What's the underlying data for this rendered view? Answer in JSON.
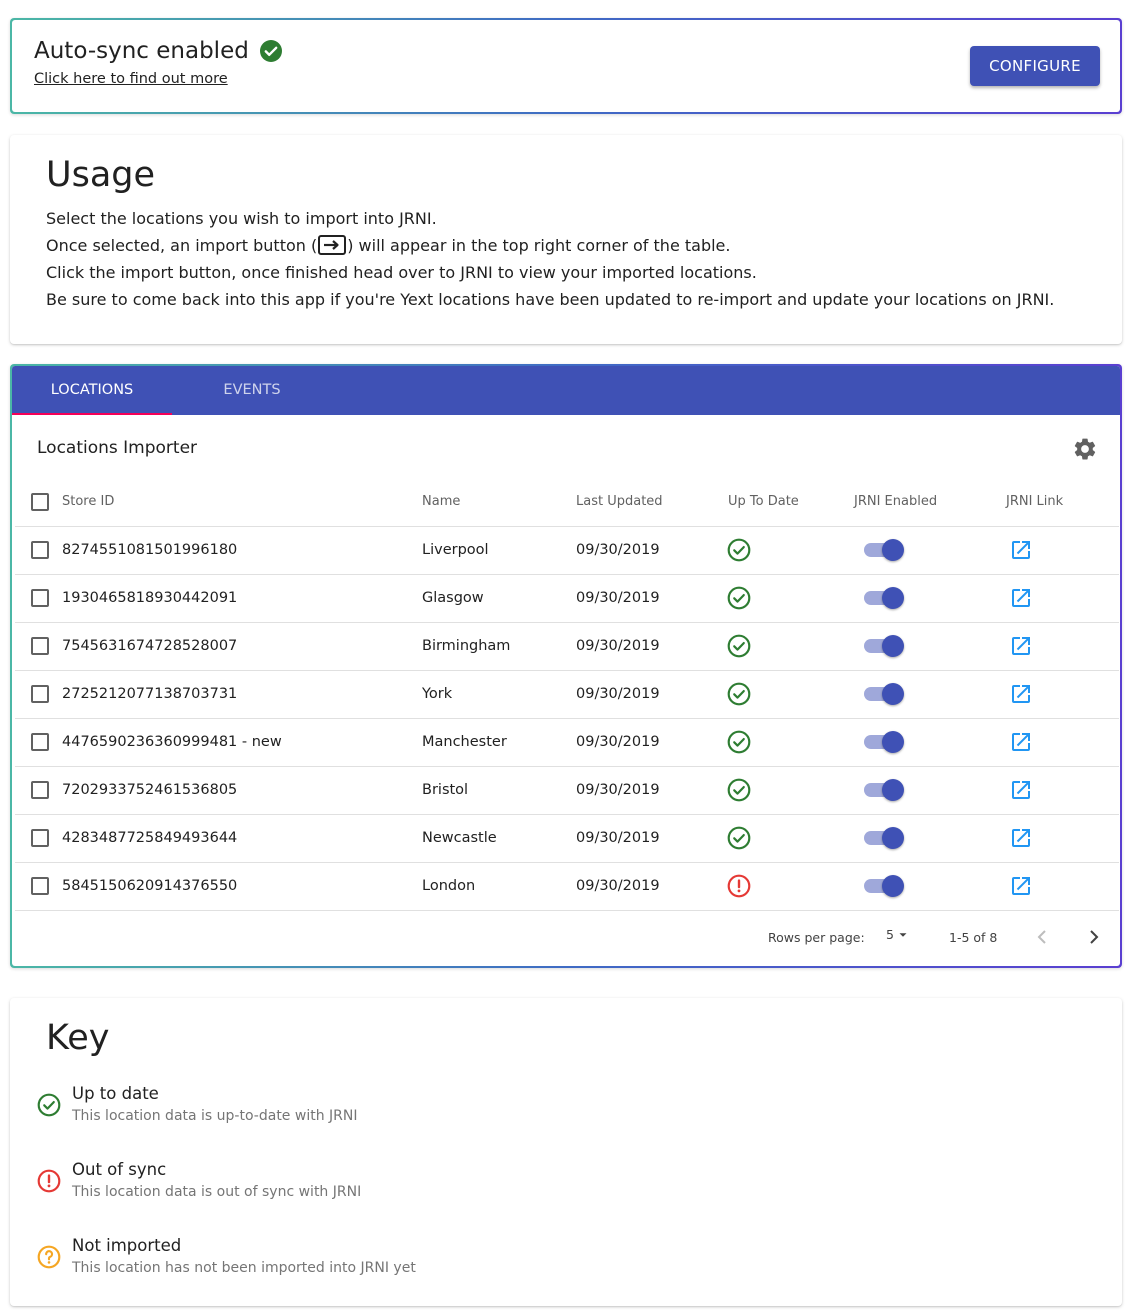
{
  "banner": {
    "title": "Auto-sync enabled",
    "link_text": "Click here to find out more",
    "configure_label": "CONFIGURE"
  },
  "usage": {
    "title": "Usage",
    "line1": "Select the locations you wish to import into JRNI.",
    "line2_before": "Once selected, an import button (",
    "line2_after": ") will appear in the top right corner of the table.",
    "line3": "Click the import button, once finished head over to JRNI to view your imported locations.",
    "line4": "Be sure to come back into this app if you're Yext locations have been updated to re-import and update your locations on JRNI."
  },
  "tabs": [
    "LOCATIONS",
    "EVENTS"
  ],
  "table": {
    "title": "Locations Importer",
    "columns": [
      "Store ID",
      "Name",
      "Last Updated",
      "Up To Date",
      "JRNI Enabled",
      "JRNI Link"
    ],
    "rows": [
      {
        "store_id": "8274551081501996180",
        "name": "Liverpool",
        "last_updated": "09/30/2019",
        "status": "up-to-date",
        "enabled": true
      },
      {
        "store_id": "1930465818930442091",
        "name": "Glasgow",
        "last_updated": "09/30/2019",
        "status": "up-to-date",
        "enabled": true
      },
      {
        "store_id": "7545631674728528007",
        "name": "Birmingham",
        "last_updated": "09/30/2019",
        "status": "up-to-date",
        "enabled": true
      },
      {
        "store_id": "2725212077138703731",
        "name": "York",
        "last_updated": "09/30/2019",
        "status": "up-to-date",
        "enabled": true
      },
      {
        "store_id": "4476590236360999481 - new",
        "name": "Manchester",
        "last_updated": "09/30/2019",
        "status": "up-to-date",
        "enabled": true
      },
      {
        "store_id": "7202933752461536805",
        "name": "Bristol",
        "last_updated": "09/30/2019",
        "status": "up-to-date",
        "enabled": true
      },
      {
        "store_id": "4283487725849493644",
        "name": "Newcastle",
        "last_updated": "09/30/2019",
        "status": "up-to-date",
        "enabled": true
      },
      {
        "store_id": "5845150620914376550",
        "name": "London",
        "last_updated": "09/30/2019",
        "status": "out-of-sync",
        "enabled": true
      }
    ],
    "rows_per_page_label": "Rows per page:",
    "rows_per_page": "5",
    "range": "1-5 of 8"
  },
  "key": {
    "title": "Key",
    "items": [
      {
        "icon": "check-circle-icon",
        "title": "Up to date",
        "subtitle": "This location data is up-to-date with JRNI",
        "color": "#2e7d32"
      },
      {
        "icon": "error-circle-icon",
        "title": "Out of sync",
        "subtitle": "This location data is out of sync with JRNI",
        "color": "#e53935"
      },
      {
        "icon": "help-circle-icon",
        "title": "Not imported",
        "subtitle": "This location has not been imported into JRNI yet",
        "color": "#f5a623"
      }
    ]
  },
  "colors": {
    "primary": "#3f51b5",
    "tab_indicator": "#f50057",
    "success": "#2e7d32",
    "error": "#e53935",
    "warning": "#f5a623",
    "link": "#2196f3"
  }
}
